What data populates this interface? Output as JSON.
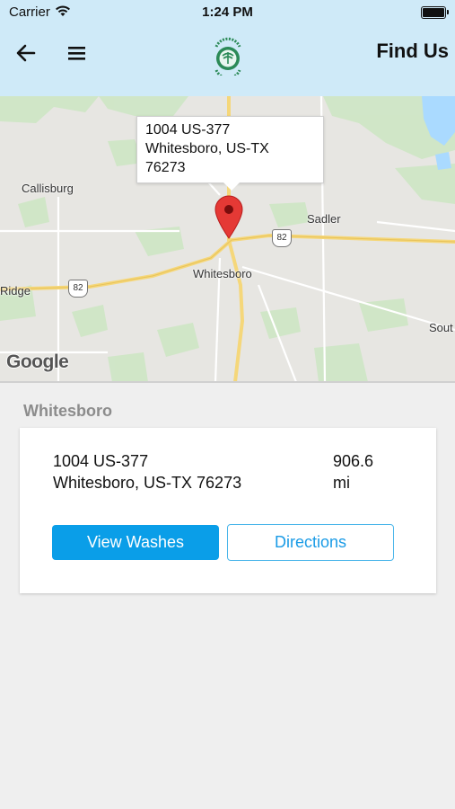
{
  "status_bar": {
    "carrier": "Carrier",
    "time": "1:24 PM"
  },
  "header": {
    "title": "Find Us",
    "icons": [
      "arrow-left-icon",
      "hamburger-menu-icon"
    ],
    "logo": "car-wash-logo"
  },
  "map": {
    "callout": {
      "line1": "1004 US-377",
      "line2": "Whitesboro, US-TX",
      "line3": "76273"
    },
    "labels": {
      "callisburg": "Callisburg",
      "sadler": "Sadler",
      "whitesboro": "Whitesboro",
      "ridge": "Ridge",
      "south": "Sout"
    },
    "shields": {
      "us82_a": "82",
      "us82_b": "82"
    },
    "attribution": "Google"
  },
  "location": {
    "section_title": "Whitesboro",
    "address_line1": "1004 US-377",
    "address_line2": "Whitesboro, US-TX  76273",
    "distance": "906.6",
    "distance_unit": "mi",
    "view_washes_label": "View Washes",
    "directions_label": "Directions"
  },
  "colors": {
    "header_bg": "#cfeaf8",
    "accent": "#0a9ee8",
    "pin": "#e53935"
  }
}
